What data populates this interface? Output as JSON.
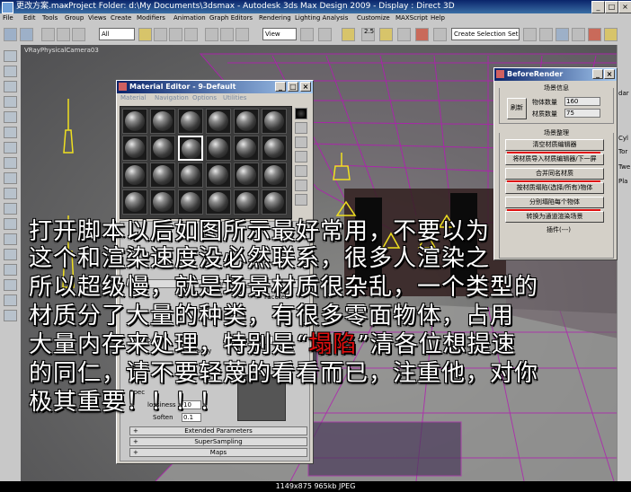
{
  "titlebar": {
    "file": "更改方案.max",
    "title": "- Project Folder: d:\\My Documents\\3dsmax - Autodesk 3ds Max Design 2009 - Display : Direct 3D"
  },
  "menus": [
    "File",
    "Edit",
    "Tools",
    "Group",
    "Views",
    "Create",
    "Modifiers",
    "Animation",
    "Graph Editors",
    "Rendering",
    "Lighting Analysis",
    "Customize",
    "MAXScript",
    "Help"
  ],
  "toolbar": {
    "filter": "All",
    "refcoord": "View",
    "selection_set": "Create Selection Set",
    "snap_label": "2.5"
  },
  "viewport": {
    "label": "VRayPhysicalCamera03"
  },
  "material_editor": {
    "title": "Material Editor - 9-Default",
    "menus": [
      "Material",
      "Navigation",
      "Options",
      "Utilities"
    ],
    "select_label": "Selec",
    "shader_label": "Shader Ba",
    "faceted": "Faceted",
    "color_label": "Color",
    "color_value": "0",
    "ambient_label": "Ambie",
    "opacity_label": "pacity",
    "specular_label": "Spe",
    "spec_level_label": "Spec",
    "glossiness_label": "lossiness",
    "glossiness_value": "10",
    "soften_label": "Soften",
    "soften_value": "0.1",
    "rollouts": [
      "Extended Parameters",
      "SuperSampling",
      "Maps"
    ]
  },
  "before_render": {
    "title": "BeforeRender",
    "scene_info_title": "场景信息",
    "refresh": "刷新",
    "object_count_label": "物体数量",
    "object_count": "160",
    "material_count_label": "材质数量",
    "material_count": "75",
    "scene_clean_title": "场景整理",
    "buttons": [
      "清空材质编辑器",
      "将材质导入材质编辑器/下一屏",
      "合并同名材质",
      "按材质塌陷(选择/所有)物体",
      "分别塌陷每个物体",
      "转换为通道渲染场景"
    ],
    "partial": "插件(---)"
  },
  "overlay": {
    "lines": [
      "打开脚本以后如图所示最好常用，不要以为",
      "这个和渲染速度没必然联系，很多人渲染之",
      "所以超级慢，就是场景材质很杂乱，一个类型的",
      "材质分了大量的种类，有很多零面物体，占用",
      "大量内存来处理，特别是“",
      "”清各位想提速",
      "的同仁，请不要轻蔑的看看而已，注重他，对你",
      "极其重要！！！！"
    ],
    "highlight": "塌陷"
  },
  "cmd_strip": [
    "dar",
    "Cyl",
    "Tor",
    "Twe",
    "Pla"
  ],
  "status": "1149x875  965kb  JPEG",
  "colors": {
    "title_blue": "#0a246a",
    "highlight_red": "#e01010",
    "wire_magenta": "#b020b0",
    "lamp_yellow": "#f0e020"
  }
}
